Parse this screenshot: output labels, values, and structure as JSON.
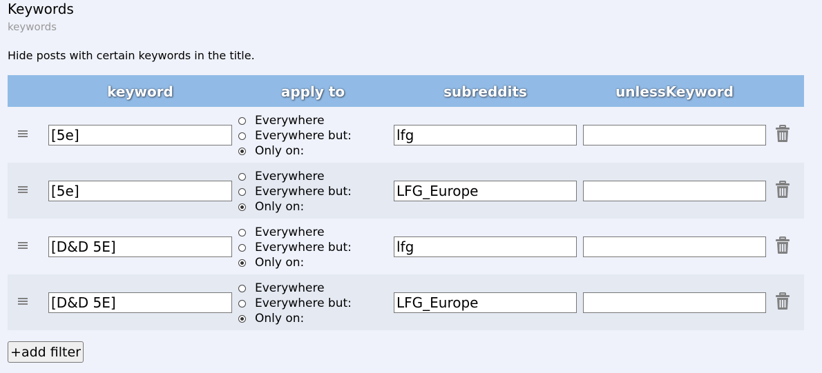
{
  "section": {
    "title": "Keywords",
    "subtitle": "keywords",
    "description": "Hide posts with certain keywords in the title."
  },
  "table": {
    "headers": {
      "keyword": "keyword",
      "apply_to": "apply to",
      "subreddits": "subreddits",
      "unless_keyword": "unlessKeyword"
    },
    "radio_labels": [
      "Everywhere",
      "Everywhere but:",
      "Only on:"
    ],
    "rows": [
      {
        "keyword": "[5e]",
        "apply_to": "Only on:",
        "subreddits": "lfg",
        "unless_keyword": ""
      },
      {
        "keyword": "[5e]",
        "apply_to": "Only on:",
        "subreddits": "LFG_Europe",
        "unless_keyword": ""
      },
      {
        "keyword": "[D&D 5E]",
        "apply_to": "Only on:",
        "subreddits": "lfg",
        "unless_keyword": ""
      },
      {
        "keyword": "[D&D 5E]",
        "apply_to": "Only on:",
        "subreddits": "LFG_Europe",
        "unless_keyword": ""
      }
    ]
  },
  "add_button_label": "+add filter",
  "icons": {
    "drag": "drag-handle-icon",
    "delete": "trash-icon"
  },
  "colors": {
    "header_bg": "#91bbe6",
    "page_bg": "#eff2fb",
    "alt_row_bg": "#e4e9f2",
    "icon_gray": "#808080"
  }
}
